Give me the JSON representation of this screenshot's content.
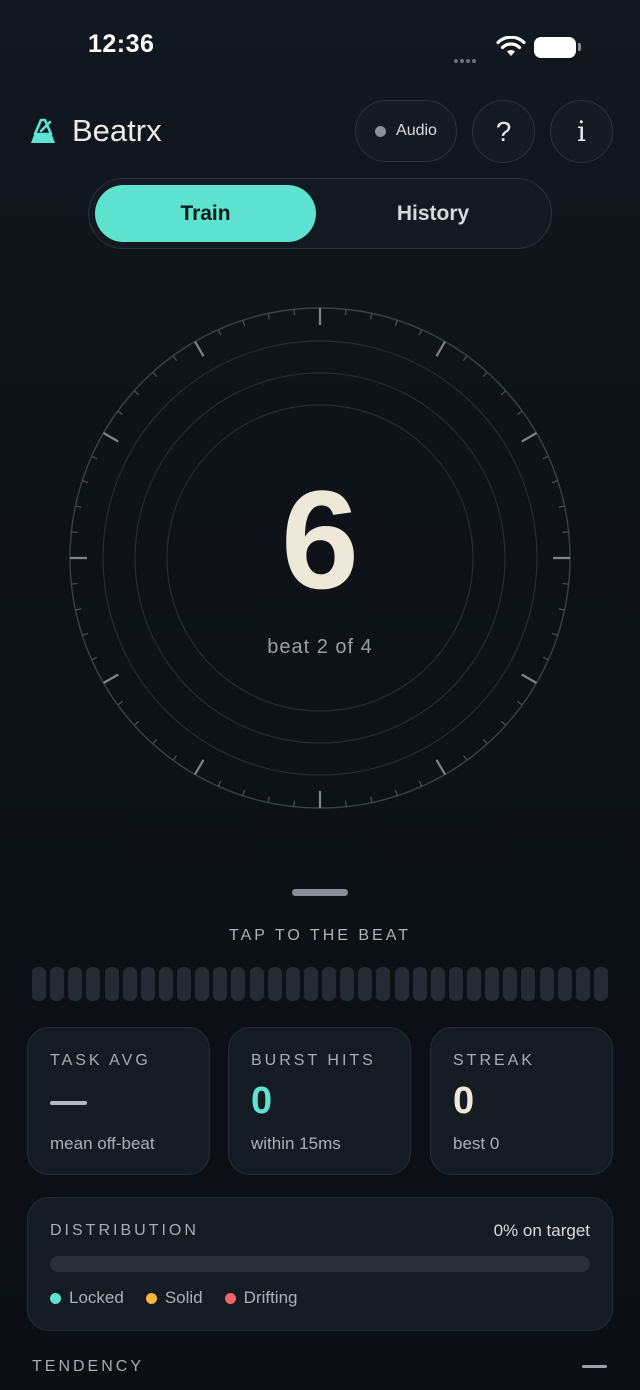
{
  "status_bar": {
    "time": "12:36"
  },
  "header": {
    "app_title": "Beatrx",
    "audio_label": "Audio",
    "help_label": "?",
    "info_label": "i"
  },
  "tabs": {
    "train": "Train",
    "history": "History",
    "active": "Train"
  },
  "dial": {
    "count": "6",
    "caption": "beat 2 of 4"
  },
  "tap": {
    "label": "TAP TO THE BEAT",
    "bar_count": 32
  },
  "stats": {
    "task_avg": {
      "title": "TASK AVG",
      "sub": "mean off-beat"
    },
    "burst_hits": {
      "title": "BURST HITS",
      "value": "0",
      "sub": "within 15ms"
    },
    "streak": {
      "title": "STREAK",
      "value": "0",
      "sub": "best 0"
    }
  },
  "distribution": {
    "title": "DISTRIBUTION",
    "on_target": "0% on target",
    "legend": [
      {
        "label": "Locked",
        "color": "#5fe3d1"
      },
      {
        "label": "Solid",
        "color": "#f4b63c"
      },
      {
        "label": "Drifting",
        "color": "#f06565"
      }
    ]
  },
  "tendency": {
    "label": "TENDENCY"
  },
  "colors": {
    "accent": "#5fe3d1",
    "value_teal": "#5fe3d1",
    "value_cream": "#eee8d8"
  }
}
